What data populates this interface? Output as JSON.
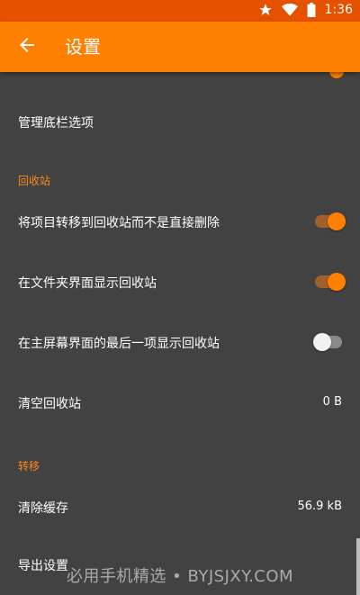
{
  "status_bar": {
    "time": "1:36",
    "icons": [
      "star-icon",
      "wifi-icon",
      "battery-icon"
    ],
    "color": "#e65100"
  },
  "app_bar": {
    "title": "设置",
    "back_icon": "arrow-back-icon",
    "color": "#ff7f00"
  },
  "settings": {
    "manage_bottom_bar": {
      "label": "管理底栏选项"
    },
    "recycle_bin_section": {
      "header": "回收站",
      "items": [
        {
          "label": "将项目转移到回收站而不是直接删除",
          "type": "toggle",
          "checked": true
        },
        {
          "label": "在文件夹界面显示回收站",
          "type": "toggle",
          "checked": true
        },
        {
          "label": "在主屏幕界面的最后一项显示回收站",
          "type": "toggle",
          "checked": false
        },
        {
          "label": "清空回收站",
          "type": "value",
          "value": "0 B"
        }
      ]
    },
    "transfer_section": {
      "header": "转移",
      "items": [
        {
          "label": "清除缓存",
          "type": "value",
          "value": "56.9 kB"
        },
        {
          "label": "导出设置",
          "type": "action"
        }
      ]
    }
  },
  "watermark": "必用手机精选 • BYJSJXY.COM",
  "colors": {
    "accent": "#ff7f00",
    "section_header": "#ff8a1c",
    "background": "#424242"
  }
}
